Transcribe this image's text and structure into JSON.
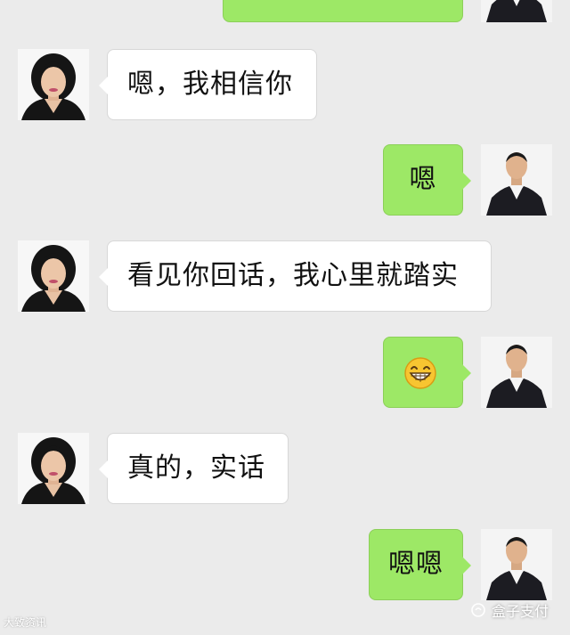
{
  "messages": [
    {
      "side": "right",
      "text": "",
      "partial": true
    },
    {
      "side": "left",
      "text": "嗯，我相信你"
    },
    {
      "side": "right",
      "text": "嗯"
    },
    {
      "side": "left",
      "text": "看见你回话，我心里就踏实"
    },
    {
      "side": "right",
      "emoji": "grinning-face-emoji"
    },
    {
      "side": "left",
      "text": "真的，实话"
    },
    {
      "side": "right",
      "text": "嗯嗯"
    }
  ],
  "avatars": {
    "left": "woman-avatar",
    "right": "man-avatar"
  },
  "watermarks": {
    "left": "大致资讯",
    "right": "盒子支付",
    "right_icon": "wechat-official-account-icon"
  },
  "colors": {
    "background": "#ebebeb",
    "bubble_left": "#ffffff",
    "bubble_right": "#9de866"
  }
}
